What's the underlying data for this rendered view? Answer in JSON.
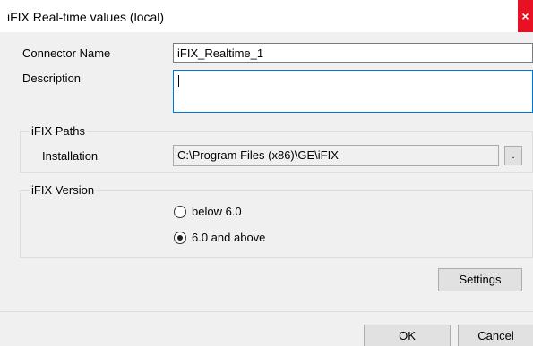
{
  "window": {
    "title": "iFIX Real-time values (local)",
    "close_glyph": "×"
  },
  "form": {
    "connector_name_label": "Connector Name",
    "connector_name_value": "iFIX_Realtime_1",
    "description_label": "Description",
    "description_value": ""
  },
  "paths_group": {
    "title": "iFIX Paths",
    "installation_label": "Installation",
    "installation_value": "C:\\Program Files (x86)\\GE\\iFIX",
    "browse_label": "."
  },
  "version_group": {
    "title": "iFIX Version",
    "options": [
      {
        "label": "below 6.0",
        "selected": false
      },
      {
        "label": "6.0 and above",
        "selected": true
      }
    ]
  },
  "buttons": {
    "settings": "Settings",
    "ok": "OK",
    "cancel": "Cancel"
  }
}
